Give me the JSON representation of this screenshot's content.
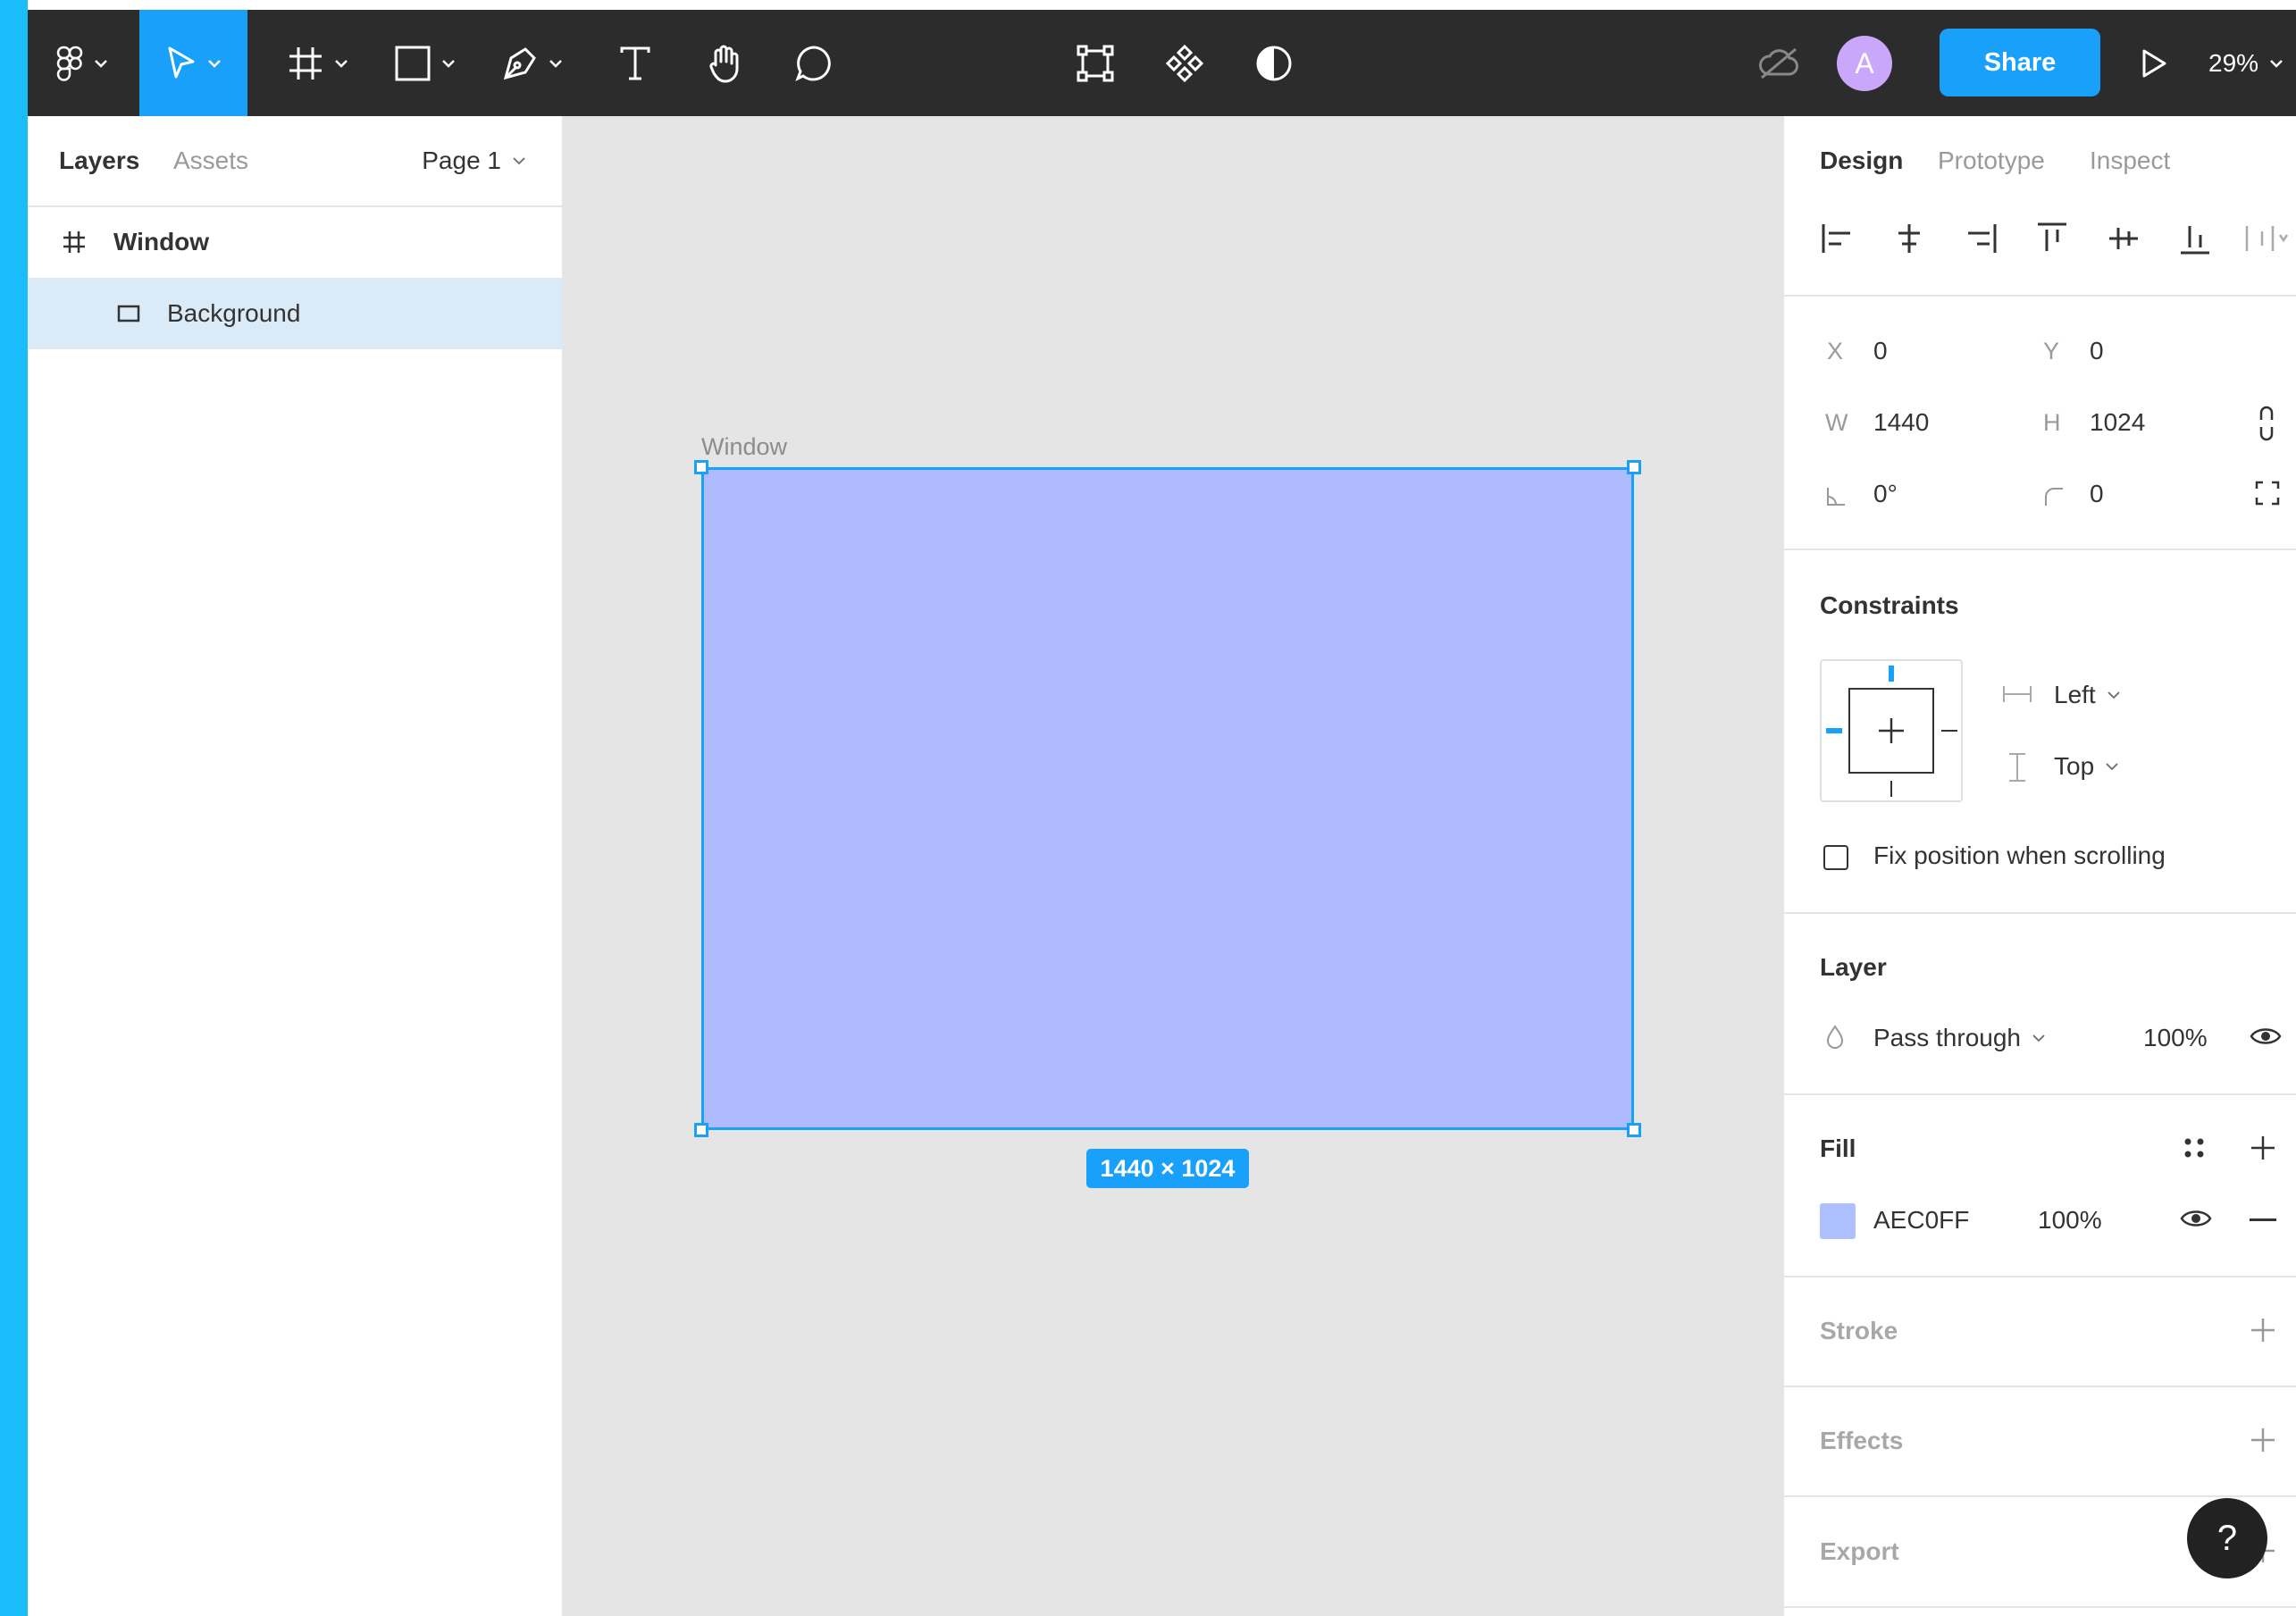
{
  "toolbar": {
    "share_label": "Share",
    "zoom_label": "29%",
    "avatar_initial": "A"
  },
  "left_panel": {
    "tabs": [
      {
        "label": "Layers",
        "active": true
      },
      {
        "label": "Assets",
        "active": false
      }
    ],
    "page_selector": "Page 1",
    "layers": [
      {
        "name": "Window",
        "icon": "frame-icon",
        "selected": false
      },
      {
        "name": "Background",
        "icon": "rectangle-icon",
        "selected": true
      }
    ]
  },
  "canvas": {
    "frame_label": "Window",
    "frame_fill": "#AEC0FF",
    "dimensions_badge": "1440 × 1024"
  },
  "right_panel": {
    "tabs": [
      {
        "label": "Design",
        "active": true
      },
      {
        "label": "Prototype",
        "active": false
      },
      {
        "label": "Inspect",
        "active": false
      }
    ],
    "position": {
      "x_label": "X",
      "x_value": "0",
      "y_label": "Y",
      "y_value": "0",
      "w_label": "W",
      "w_value": "1440",
      "h_label": "H",
      "h_value": "1024",
      "rotation_value": "0°",
      "radius_value": "0"
    },
    "constraints": {
      "title": "Constraints",
      "horizontal": "Left",
      "vertical": "Top",
      "fix_position_label": "Fix position when scrolling",
      "fix_position_checked": false
    },
    "layer": {
      "title": "Layer",
      "blend_mode": "Pass through",
      "opacity": "100%"
    },
    "fill": {
      "title": "Fill",
      "hex": "AEC0FF",
      "swatch_color": "#AEC0FF",
      "opacity": "100%"
    },
    "stroke": {
      "title": "Stroke"
    },
    "effects": {
      "title": "Effects"
    },
    "export": {
      "title": "Export"
    }
  },
  "help": {
    "label": "?"
  },
  "colors": {
    "accent": "#18A0FB",
    "toolbar_bg": "#2C2C2C",
    "canvas_bg": "#E5E5E5",
    "selected_layer_bg": "#DAEBF7"
  }
}
